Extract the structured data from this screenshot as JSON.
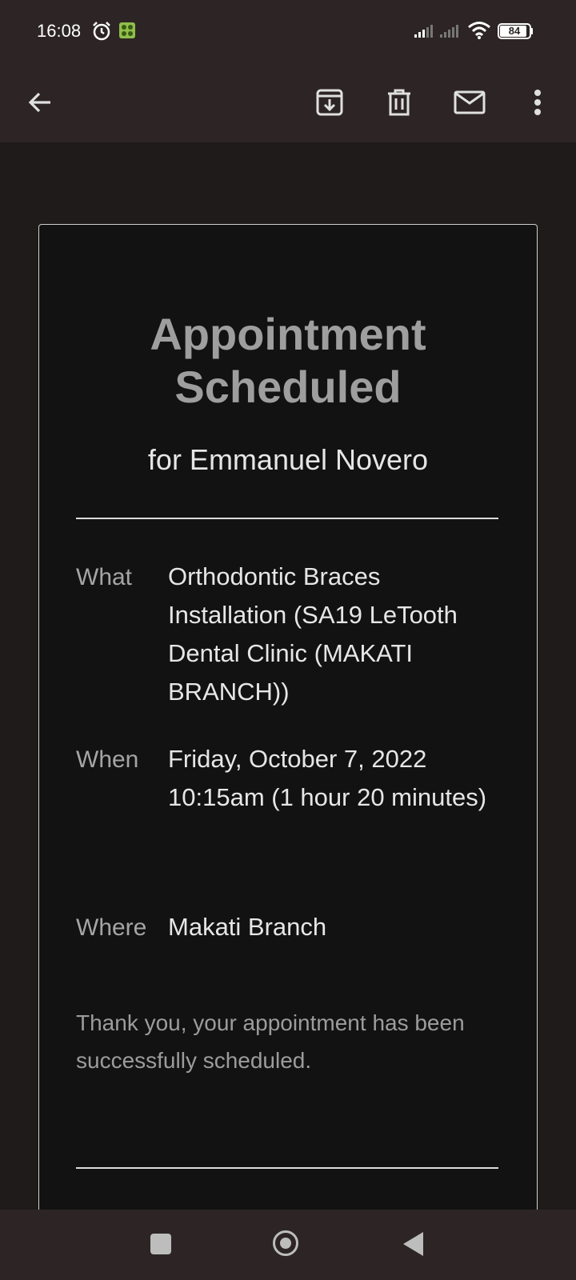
{
  "status_bar": {
    "time": "16:08",
    "battery_level": "84",
    "icons": [
      "alarm-icon",
      "app-notification-icon",
      "signal-icon",
      "signal-icon",
      "wifi-icon",
      "battery-icon"
    ]
  },
  "toolbar": {
    "icons": [
      "back-arrow-icon",
      "archive-icon",
      "delete-icon",
      "mark-unread-icon",
      "more-vert-icon"
    ]
  },
  "email": {
    "title_line1": "Appointment",
    "title_line2": "Scheduled",
    "subtitle": "for Emmanuel Novero",
    "what_label": "What",
    "what_value": "Orthodontic Braces Installation (SA19 LeTooth Dental Clinic (MAKATI BRANCH))",
    "when_label": "When",
    "when_value": "Friday, October 7, 2022 10:15am (1 hour 20 minutes)",
    "where_label": "Where",
    "where_value": "Makati Branch",
    "thanks": "Thank you, your appointment has been successfully scheduled."
  },
  "navbar": {
    "icons": [
      "recents-square-icon",
      "home-circle-icon",
      "back-triangle-icon"
    ]
  },
  "colors": {
    "bars": "#2d2525",
    "card_bg": "#121212",
    "title_gray": "#9e9e9e"
  }
}
